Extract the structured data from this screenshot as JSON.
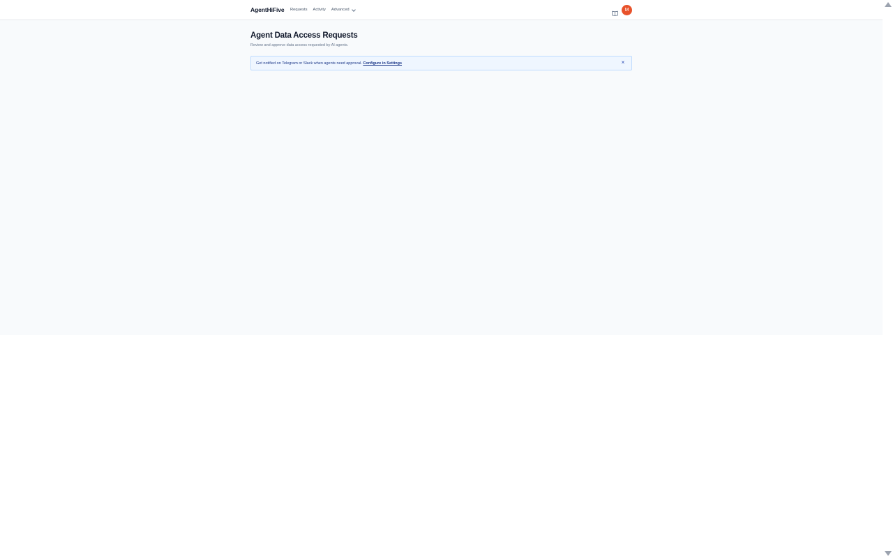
{
  "header": {
    "brand": "AgentHiFive",
    "nav": [
      {
        "label": "Requests"
      },
      {
        "label": "Activity"
      },
      {
        "label": "Advanced"
      }
    ],
    "docs_icon": "book-icon",
    "avatar_initial": "M"
  },
  "main": {
    "title": "Agent Data Access Requests",
    "subtitle": "Review and approve data access requested by AI agents."
  },
  "banner": {
    "text": "Get notified on Telegram or Slack when agents need approval.",
    "link_label": "Configure in Settings",
    "close_icon": "close-icon",
    "close_glyph": "×"
  },
  "colors": {
    "app_background": "#f8fafc",
    "avatar": "#e8522b",
    "banner_background": "#eff6ff",
    "banner_border": "#bfdbfe",
    "banner_text": "#1e3a8a"
  }
}
